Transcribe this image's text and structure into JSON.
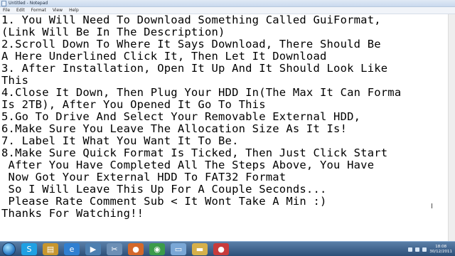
{
  "window": {
    "title": "Untitled - Notepad"
  },
  "menu": [
    "File",
    "Edit",
    "Format",
    "View",
    "Help"
  ],
  "lines": [
    "1. You Will Need To Download Something Called GuiFormat,",
    "(Link Will Be In The Description)",
    "2.Scroll Down To Where It Says Download, There Should Be",
    "A Here Underlined Click It, Then Let It Download",
    "3. After Installation, Open It Up And It Should Look Like",
    "This",
    "4.Close It Down, Then Plug Your HDD In(The Max It Can Forma",
    "Is 2TB), After You Opened It Go To This",
    "5.Go To Drive And Select Your Removable External HDD,",
    "6.Make Sure You Leave The Allocation Size As It Is!",
    "7. Label It What You Want It To Be.",
    "8.Make Sure Quick Format Is Ticked, Then Just Click Start",
    " After You Have Completed All The Steps Above, You Have",
    " Now Got Your External HDD To FAT32 Format",
    " So I Will Leave This Up For A Couple Seconds...",
    " Please Rate Comment Sub < It Wont Take A Min :)",
    "Thanks For Watching!!"
  ],
  "taskbar": {
    "icons": [
      {
        "name": "skype-icon",
        "glyph": "S",
        "color": "#1fa0e3"
      },
      {
        "name": "explorer-icon",
        "glyph": "▤",
        "color": "#c7962e"
      },
      {
        "name": "internet-explorer-icon",
        "glyph": "e",
        "color": "#2f7fd1"
      },
      {
        "name": "media-icon",
        "glyph": "▶",
        "color": "#4d7fb0"
      },
      {
        "name": "scissors-icon",
        "glyph": "✂",
        "color": "#6c8fb5"
      },
      {
        "name": "firefox-icon",
        "glyph": "●",
        "color": "#d4682a"
      },
      {
        "name": "chrome-icon",
        "glyph": "◉",
        "color": "#3b9b4a"
      },
      {
        "name": "notepad-icon",
        "glyph": "▭",
        "color": "#7aa7d6"
      },
      {
        "name": "folder-icon",
        "glyph": "▬",
        "color": "#d6b04a"
      },
      {
        "name": "record-icon",
        "glyph": "●",
        "color": "#c83b3b"
      }
    ],
    "clock": {
      "time": "18:08",
      "date": "30/12/2011"
    }
  }
}
